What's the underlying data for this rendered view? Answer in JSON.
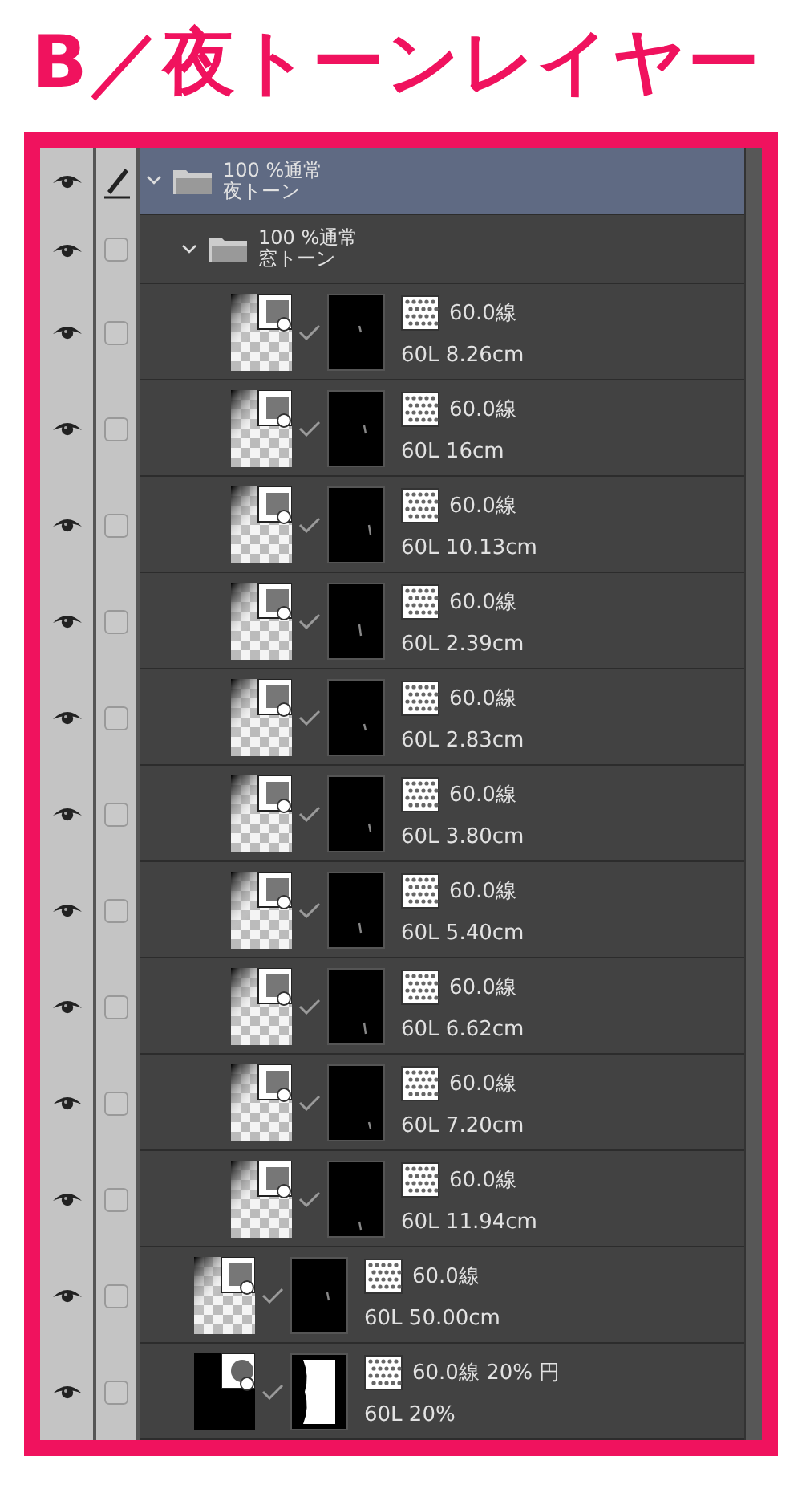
{
  "title": "B／夜トーンレイヤー",
  "layers": [
    {
      "kind": "folder",
      "visible": true,
      "selected": true,
      "expanded": true,
      "blend": "100 %通常",
      "name": "夜トーン",
      "children": [
        {
          "kind": "folder",
          "visible": true,
          "selected": false,
          "expanded": true,
          "blend": "100 %通常",
          "name": "窓トーン",
          "children": [
            {
              "kind": "tone",
              "visible": true,
              "selected": false,
              "screen": "60.0線",
              "name": "60L 8.26cm"
            },
            {
              "kind": "tone",
              "visible": true,
              "selected": false,
              "screen": "60.0線",
              "name": "60L 16cm"
            },
            {
              "kind": "tone",
              "visible": true,
              "selected": false,
              "screen": "60.0線",
              "name": "60L 10.13cm"
            },
            {
              "kind": "tone",
              "visible": true,
              "selected": false,
              "screen": "60.0線",
              "name": "60L 2.39cm"
            },
            {
              "kind": "tone",
              "visible": true,
              "selected": false,
              "screen": "60.0線",
              "name": "60L 2.83cm"
            },
            {
              "kind": "tone",
              "visible": true,
              "selected": false,
              "screen": "60.0線",
              "name": "60L 3.80cm"
            },
            {
              "kind": "tone",
              "visible": true,
              "selected": false,
              "screen": "60.0線",
              "name": "60L 5.40cm"
            },
            {
              "kind": "tone",
              "visible": true,
              "selected": false,
              "screen": "60.0線",
              "name": "60L 6.62cm"
            },
            {
              "kind": "tone",
              "visible": true,
              "selected": false,
              "screen": "60.0線",
              "name": "60L 7.20cm"
            },
            {
              "kind": "tone",
              "visible": true,
              "selected": false,
              "screen": "60.0線",
              "name": "60L 11.94cm"
            }
          ]
        },
        {
          "kind": "tone",
          "visible": true,
          "selected": false,
          "screen": "60.0線",
          "name": "60L 50.00cm"
        },
        {
          "kind": "circle-tone",
          "visible": true,
          "selected": false,
          "screen": "60.0線 20% 円",
          "name": "60L 20%"
        }
      ]
    }
  ]
}
